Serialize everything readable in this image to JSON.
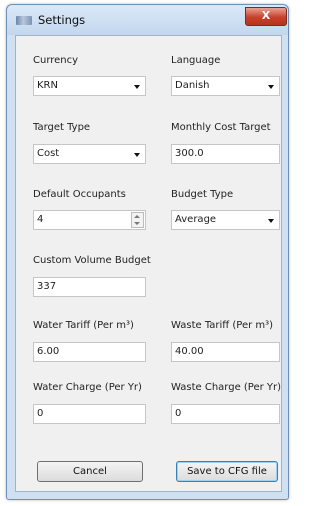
{
  "window": {
    "title": "Settings",
    "close_label": "X"
  },
  "currency": {
    "label": "Currency",
    "value": "KRN"
  },
  "language": {
    "label": "Language",
    "value": "Danish"
  },
  "target_type": {
    "label": "Target Type",
    "value": "Cost"
  },
  "monthly_cost_target": {
    "label": "Monthly Cost Target",
    "value": "300.0"
  },
  "default_occupants": {
    "label": "Default Occupants",
    "value": "4"
  },
  "budget_type": {
    "label": "Budget Type",
    "value": "Average"
  },
  "custom_volume_budget": {
    "label": "Custom Volume Budget",
    "value": "337"
  },
  "water_tariff": {
    "label": "Water Tariff (Per m³)",
    "value": "6.00"
  },
  "waste_tariff": {
    "label": "Waste Tariff (Per m³)",
    "value": "40.00"
  },
  "water_charge": {
    "label": "Water Charge (Per Yr)",
    "value": "0"
  },
  "waste_charge": {
    "label": "Waste Charge (Per Yr)",
    "value": "0"
  },
  "buttons": {
    "cancel": "Cancel",
    "save": "Save to CFG file"
  }
}
